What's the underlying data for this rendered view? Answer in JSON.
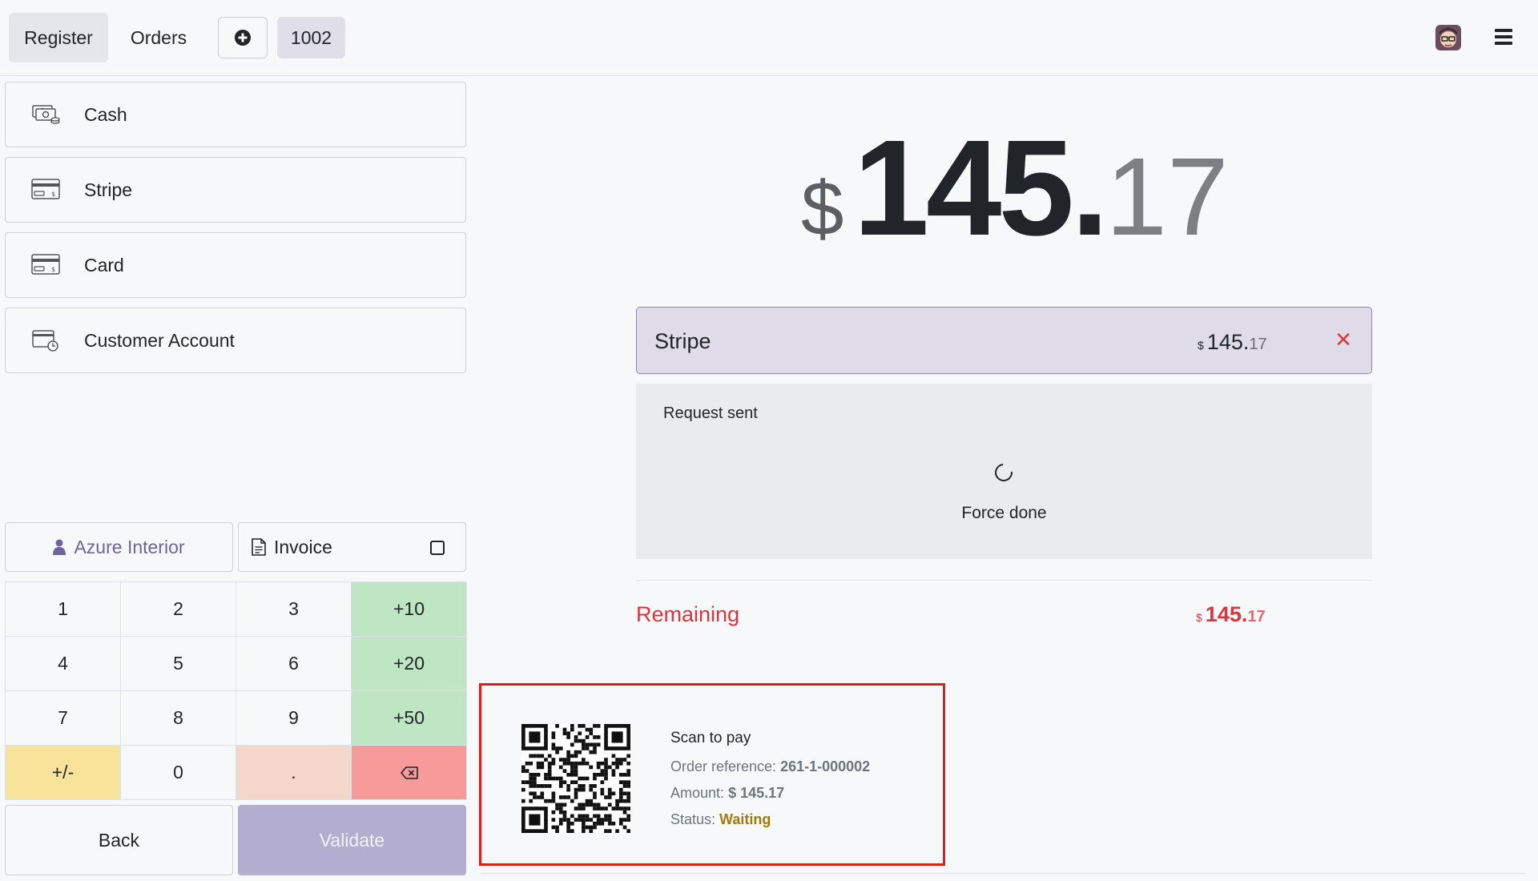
{
  "header": {
    "register_label": "Register",
    "orders_label": "Orders",
    "add_icon": "plus-circle-icon",
    "order_number": "1002",
    "menu_icon": "hamburger-icon"
  },
  "payment_methods": [
    {
      "label": "Cash",
      "icon": "cash-icon"
    },
    {
      "label": "Stripe",
      "icon": "card-icon"
    },
    {
      "label": "Card",
      "icon": "card-icon"
    },
    {
      "label": "Customer Account",
      "icon": "customer-account-icon"
    }
  ],
  "partner": {
    "label": "Azure Interior"
  },
  "invoice": {
    "label": "Invoice",
    "checked": false
  },
  "numpad": {
    "keys": [
      "1",
      "2",
      "3",
      "+10",
      "4",
      "5",
      "6",
      "+20",
      "7",
      "8",
      "9",
      "+50",
      "+/-",
      "0",
      "."
    ]
  },
  "actions": {
    "back_label": "Back",
    "validate_label": "Validate"
  },
  "total": {
    "currency": "$",
    "integer": "145.",
    "decimal": "17"
  },
  "payment_line": {
    "name": "Stripe",
    "currency": "$",
    "integer": "145.",
    "decimal": "17"
  },
  "status": {
    "request_text": "Request sent",
    "force_done_label": "Force done"
  },
  "remaining": {
    "label": "Remaining",
    "currency": "$",
    "integer": "145.",
    "decimal": "17"
  },
  "qr_popup": {
    "title": "Scan to pay",
    "order_ref_label": "Order reference:",
    "order_ref_value": "261-1-000002",
    "amount_label": "Amount:",
    "amount_value": "$ 145.17",
    "status_label": "Status:",
    "status_value": "Waiting"
  },
  "colors": {
    "accent": "#71639e",
    "danger": "#d9363e",
    "waiting": "#a07a0a",
    "highlight_box": "#e31b1b"
  }
}
